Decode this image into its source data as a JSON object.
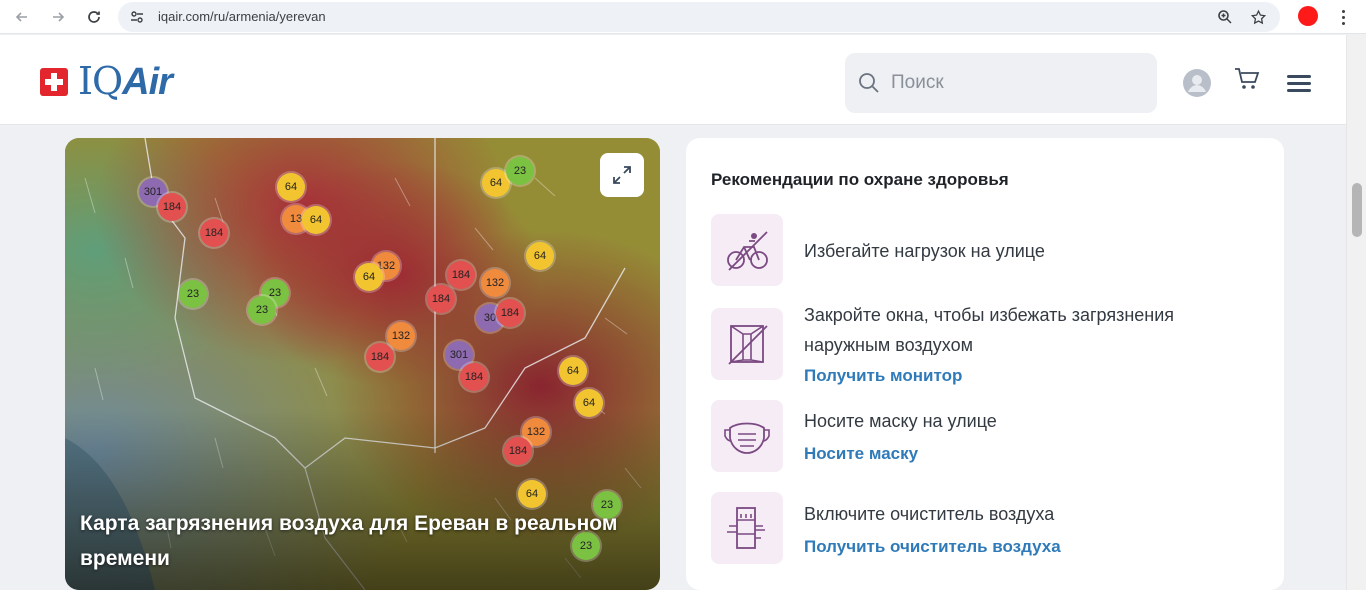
{
  "browser": {
    "url": "iqair.com/ru/armenia/yerevan",
    "icons": [
      "back-arrow-icon",
      "forward-arrow-icon",
      "reload-icon",
      "site-settings-icon",
      "zoom-icon",
      "star-icon",
      "kebab-menu-icon"
    ]
  },
  "header": {
    "logo_iq": "IQ",
    "logo_air": "Air",
    "search_placeholder": "Поиск"
  },
  "map": {
    "title": "Карта загрязнения воздуха для Ереван в реальном времени",
    "markers": [
      {
        "value": "301",
        "color": "#8e6bb0"
      },
      {
        "value": "184",
        "color": "#e2504f"
      },
      {
        "value": "184",
        "color": "#e2504f"
      },
      {
        "value": "64",
        "color": "#f2c530"
      },
      {
        "value": "13",
        "color": "#f08a3c"
      },
      {
        "value": "64",
        "color": "#f2c530"
      },
      {
        "value": "64",
        "color": "#f2c530"
      },
      {
        "value": "23",
        "color": "#7cc242"
      },
      {
        "value": "64",
        "color": "#f2c530"
      },
      {
        "value": "132",
        "color": "#f08a3c"
      },
      {
        "value": "64",
        "color": "#f2c530"
      },
      {
        "value": "23",
        "color": "#7cc242"
      },
      {
        "value": "23",
        "color": "#7cc242"
      },
      {
        "value": "23",
        "color": "#7cc242"
      },
      {
        "value": "184",
        "color": "#e2504f"
      },
      {
        "value": "132",
        "color": "#f08a3c"
      },
      {
        "value": "184",
        "color": "#e2504f"
      },
      {
        "value": "30",
        "color": "#8e6bb0"
      },
      {
        "value": "184",
        "color": "#e2504f"
      },
      {
        "value": "132",
        "color": "#f08a3c"
      },
      {
        "value": "184",
        "color": "#e2504f"
      },
      {
        "value": "301",
        "color": "#8e6bb0"
      },
      {
        "value": "184",
        "color": "#e2504f"
      },
      {
        "value": "64",
        "color": "#f2c530"
      },
      {
        "value": "64",
        "color": "#f2c530"
      },
      {
        "value": "132",
        "color": "#f08a3c"
      },
      {
        "value": "184",
        "color": "#e2504f"
      },
      {
        "value": "64",
        "color": "#f2c530"
      },
      {
        "value": "23",
        "color": "#7cc242"
      },
      {
        "value": "23",
        "color": "#7cc242"
      }
    ]
  },
  "recommendations": {
    "title": "Рекомендации по охране здоровья",
    "items": [
      {
        "text": "Избегайте нагрузок на улице",
        "link": "",
        "icon": "no-cycling-icon"
      },
      {
        "text": "Закройте окна, чтобы избежать загрязнения наружным воздухом",
        "link": "Получить монитор",
        "icon": "closed-window-icon"
      },
      {
        "text": "Носите маску на улице",
        "link": "Носите маску",
        "icon": "face-mask-icon"
      },
      {
        "text": "Включите очиститель воздуха",
        "link": "Получить очиститель воздуха",
        "icon": "air-purifier-icon"
      }
    ]
  }
}
